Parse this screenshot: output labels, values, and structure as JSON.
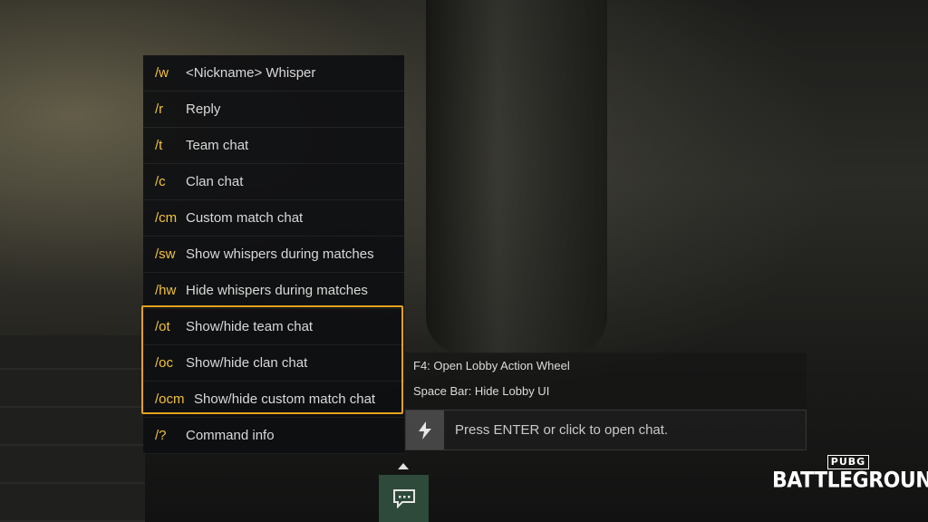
{
  "commands": [
    {
      "code": "/w",
      "desc": "<Nickname> Whisper"
    },
    {
      "code": "/r",
      "desc": "Reply"
    },
    {
      "code": "/t",
      "desc": "Team chat"
    },
    {
      "code": "/c",
      "desc": "Clan chat"
    },
    {
      "code": "/cm",
      "desc": "Custom match chat"
    },
    {
      "code": "/sw",
      "desc": "Show whispers during matches"
    },
    {
      "code": "/hw",
      "desc": "Hide whispers during matches"
    },
    {
      "code": "/ot",
      "desc": "Show/hide team chat"
    },
    {
      "code": "/oc",
      "desc": "Show/hide clan chat"
    },
    {
      "code": "/ocm",
      "desc": "Show/hide custom match chat"
    },
    {
      "code": "/?",
      "desc": "Command info"
    }
  ],
  "hints": {
    "lobby_wheel": "F4: Open Lobby Action Wheel",
    "hide_ui": "Space Bar: Hide Lobby UI"
  },
  "chat": {
    "prompt": "Press ENTER or click to open chat."
  },
  "logo": {
    "small": "PUBG",
    "big": "BATTLEGROUNDS"
  },
  "colors": {
    "command_code": "#f2c23a",
    "highlight_border": "#e3a21f",
    "chat_toggle_bg": "#2e4a3a"
  },
  "icons": {
    "chat_input": "lightning-bolt-icon",
    "chat_toggle": "chat-bubble-icon",
    "expand": "triangle-up-icon"
  }
}
